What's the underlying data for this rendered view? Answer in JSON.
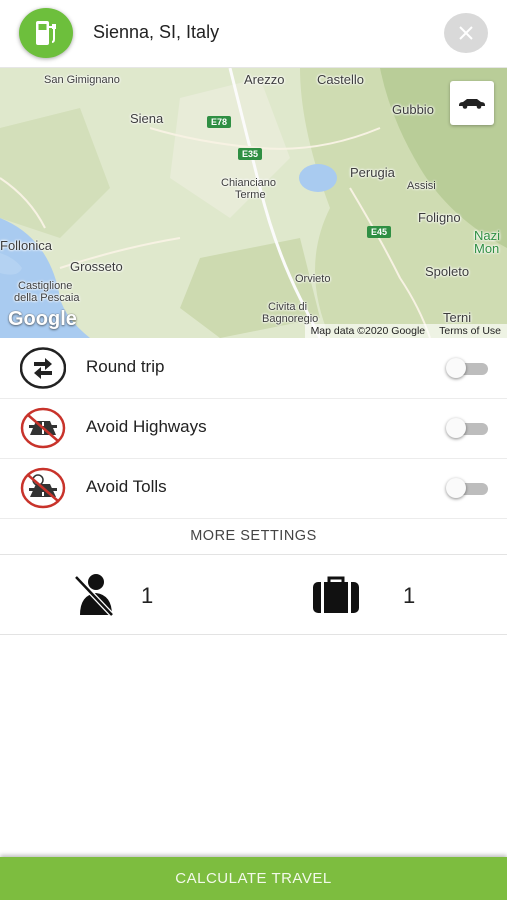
{
  "header": {
    "location": "Sienna, SI, Italy",
    "fuel_icon": "fuel-pump-icon",
    "close_icon": "close-icon",
    "accent_color": "#6dbf3c"
  },
  "map": {
    "places": [
      "San Gimignano",
      "Arezzo",
      "Castello",
      "Gubbio",
      "Siena",
      "Chianciano",
      "Terme",
      "Perugia",
      "Assisi",
      "Foligno",
      "Follonica",
      "Grosseto",
      "Nazi",
      "Mon",
      "Orvieto",
      "Spoleto",
      "Castiglione",
      "della Pescaia",
      "Civita di",
      "Bagnoregio",
      "Terni"
    ],
    "roads": [
      "E78",
      "E35",
      "E45"
    ],
    "logo": "Google",
    "attribution": "Map data ©2020 Google",
    "terms": "Terms of Use",
    "vehicle_icon": "car-icon"
  },
  "options": [
    {
      "label": "Round trip",
      "icon": "round-trip-icon",
      "enabled": false
    },
    {
      "label": "Avoid Highways",
      "icon": "no-highway-icon",
      "enabled": false
    },
    {
      "label": "Avoid Tolls",
      "icon": "no-toll-icon",
      "enabled": false
    }
  ],
  "more_settings": "MORE SETTINGS",
  "counters": {
    "passengers": {
      "icon": "passenger-seatbelt-icon",
      "value": "1"
    },
    "luggage": {
      "icon": "suitcase-icon",
      "value": "1"
    }
  },
  "calculate_button": "CALCULATE TRAVEL",
  "button_color": "#7dbd3f"
}
